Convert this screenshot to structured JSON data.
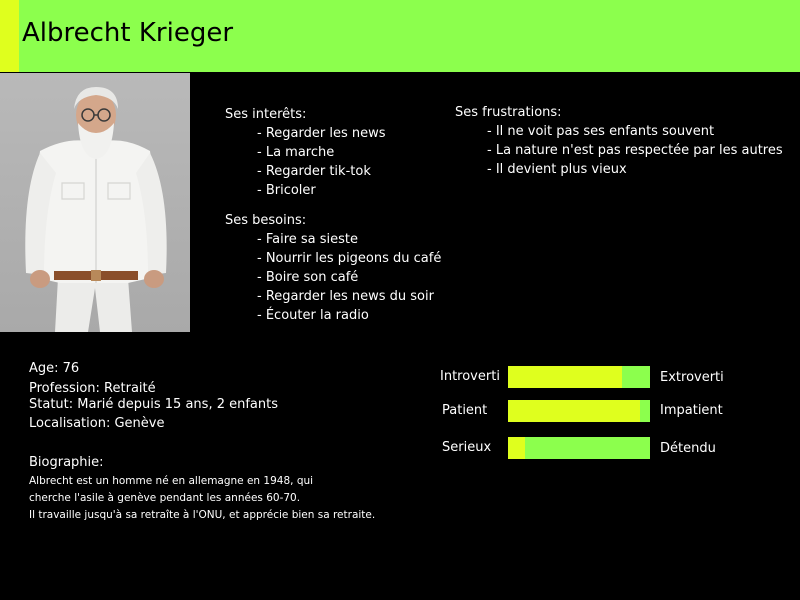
{
  "colors": {
    "header_green": "#8cff4d",
    "accent_yellow": "#dfff1e",
    "background": "#000000",
    "text": "#ffffff"
  },
  "header": {
    "name": "Albrecht Krieger"
  },
  "interests": {
    "title": "Ses interêts:",
    "items": [
      "Regarder les news",
      "La marche",
      "Regarder tik-tok",
      "Bricoler"
    ]
  },
  "needs": {
    "title": "Ses besoins:",
    "items": [
      "Faire sa sieste",
      "Nourrir les pigeons du café",
      "Boire son café",
      "Regarder les news du soir",
      "Écouter la radio"
    ]
  },
  "frustrations": {
    "title": "Ses frustrations:",
    "items": [
      "Il ne voit pas ses enfants souvent",
      "La nature n'est pas respectée par les autres",
      "Il devient plus vieux"
    ]
  },
  "facts": {
    "age": "Age: 76",
    "profession": "Profession: Retraité",
    "statut": "Statut: Marié depuis 15 ans, 2 enfants",
    "localisation": "Localisation: Genève"
  },
  "biography": {
    "title": "Biographie:",
    "lines": [
      "Albrecht est un homme né en allemagne en 1948, qui",
      "cherche l'asile à genève pendant les années 60-70.",
      "Il travaille jusqu'à sa retraîte à l'ONU, et apprécie bien sa retraite."
    ]
  },
  "traits": [
    {
      "left": "Introverti",
      "right": "Extroverti",
      "level": 0.8
    },
    {
      "left": "Patient",
      "right": "Impatient",
      "level": 0.93
    },
    {
      "left": "Serieux",
      "right": "Détendu",
      "level": 0.12
    }
  ]
}
